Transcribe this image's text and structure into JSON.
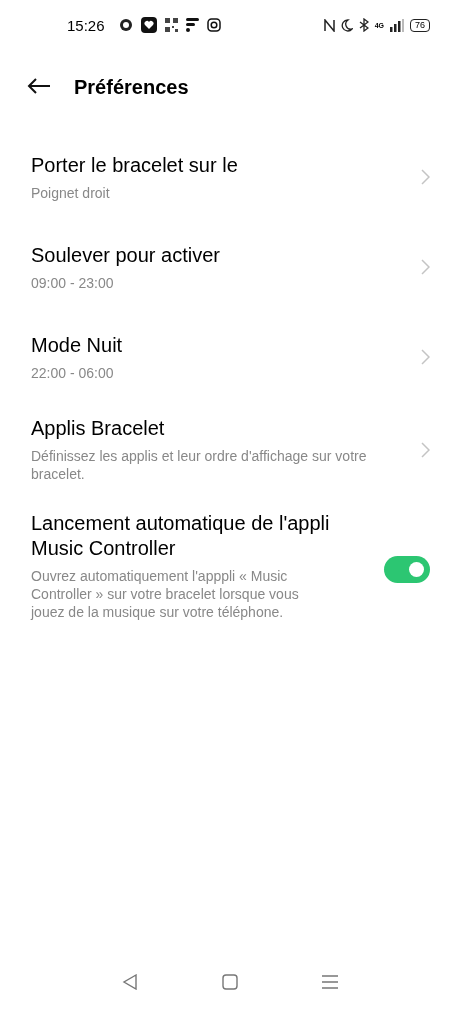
{
  "status_bar": {
    "time": "15:26",
    "battery": "76",
    "network": "4G"
  },
  "header": {
    "title": "Préférences"
  },
  "items": [
    {
      "kind": "link",
      "title": "Porter le bracelet sur le",
      "subtitle": "Poignet droit"
    },
    {
      "kind": "link",
      "title": "Soulever pour activer",
      "subtitle": "09:00 - 23:00"
    },
    {
      "kind": "link",
      "title": "Mode Nuit",
      "subtitle": "22:00 - 06:00"
    },
    {
      "kind": "link",
      "title": "Applis Bracelet",
      "subtitle": "Définissez les applis et leur ordre d'affichage sur votre bracelet."
    },
    {
      "kind": "switch",
      "title": "Lancement automatique de l'appli Music Controller",
      "subtitle": "Ouvrez automatiquement l'apppli « Music Controller » sur votre bracelet lorsque vous jouez de la musique sur votre téléphone.",
      "on": true
    }
  ]
}
